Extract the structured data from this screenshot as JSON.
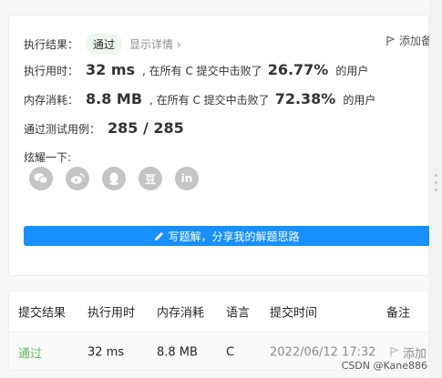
{
  "summary": {
    "result_label": "执行结果：",
    "result_value": "通过",
    "show_detail": "显示详情",
    "add_note": "添加备",
    "runtime_label": "执行用时：",
    "runtime_value": "32 ms",
    "runtime_beat_prefix": ", 在所有 C 提交中击败了",
    "runtime_percent": "26.77%",
    "runtime_suffix": "的用户",
    "memory_label": "内存消耗：",
    "memory_value": "8.8 MB",
    "memory_beat_prefix": ", 在所有 C 提交中击败了",
    "memory_percent": "72.38%",
    "memory_suffix": "的用户",
    "tests_label": "通过测试用例：",
    "tests_value": "285 / 285"
  },
  "share": {
    "label": "炫耀一下:",
    "icons": [
      "wechat-icon",
      "weibo-icon",
      "qq-icon",
      "douban-icon",
      "linkedin-icon"
    ],
    "douban_glyph": "豆",
    "linkedin_glyph": "in"
  },
  "write_button": {
    "label": "写题解，分享我的解题思路"
  },
  "table": {
    "headers": [
      "提交结果",
      "执行用时",
      "内存消耗",
      "语言",
      "提交时间",
      "备注"
    ],
    "rows": [
      {
        "result": "通过",
        "runtime": "32 ms",
        "memory": "8.8 MB",
        "language": "C",
        "time": "2022/06/12 17:32",
        "note": "添加"
      }
    ]
  },
  "watermark": "CSDN @Kane886",
  "colors": {
    "accent": "#1890ff",
    "success": "#5cb85c",
    "muted": "#8c8c8c"
  }
}
